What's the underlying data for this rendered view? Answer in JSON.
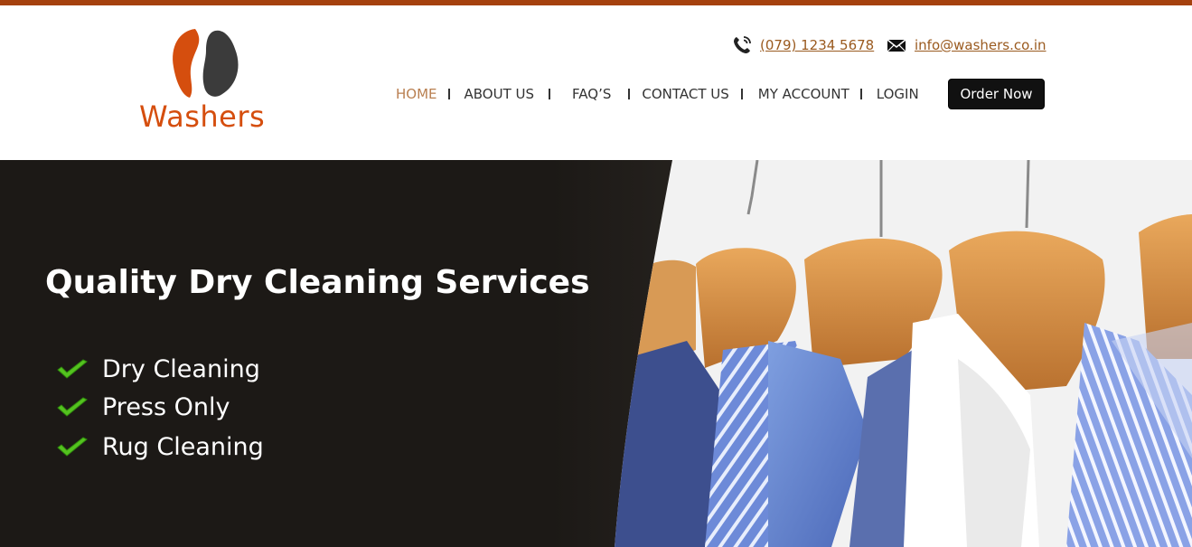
{
  "brand": {
    "name": "Washers",
    "logo_icon": "coffee-bean-logo-icon",
    "colors": {
      "orange": "#d54e0e",
      "dark": "#3b3b3b",
      "top_bar": "#a5410e"
    }
  },
  "contact": {
    "phone": "(079) 1234 5678",
    "phone_icon": "phone-icon",
    "email": "info@washers.co.in",
    "email_icon": "envelope-icon"
  },
  "nav": {
    "items": [
      {
        "label": "HOME",
        "active": true
      },
      {
        "label": "ABOUT US",
        "active": false
      },
      {
        "label": "FAQ’S",
        "active": false
      },
      {
        "label": "CONTACT US",
        "active": false
      },
      {
        "label": "MY ACCOUNT",
        "active": false
      },
      {
        "label": "LOGIN",
        "active": false
      }
    ],
    "cta": "Order Now"
  },
  "hero": {
    "title": "Quality Dry Cleaning Services",
    "services": [
      "Dry Cleaning",
      "Press Only",
      "Rug Cleaning"
    ],
    "check_icon": "green-check-icon",
    "image": "shirts-on-hangers-photo"
  }
}
